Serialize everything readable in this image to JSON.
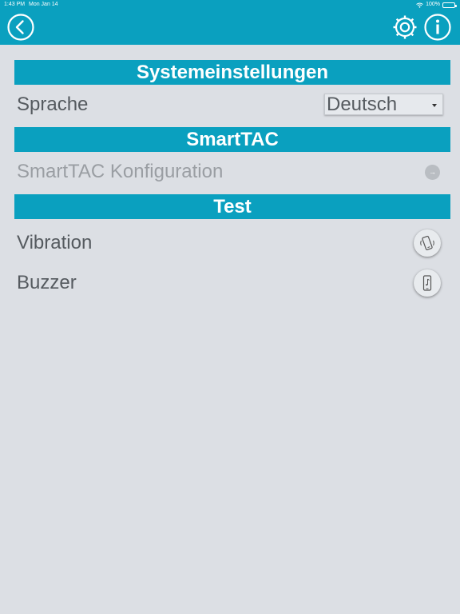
{
  "status_bar": {
    "time": "1:43 PM",
    "date": "Mon Jan 14",
    "battery": "100%"
  },
  "navbar": {
    "back_icon": "chevron-left-circle-icon",
    "settings_icon": "gear-icon",
    "info_icon": "info-circle-icon"
  },
  "sections": {
    "system": {
      "title": "Systemeinstellungen",
      "language_label": "Sprache",
      "language_value": "Deutsch"
    },
    "smarttac": {
      "title": "SmartTAC",
      "config_label": "SmartTAC Konfiguration",
      "config_icon": "→"
    },
    "test": {
      "title": "Test",
      "vibration_label": "Vibration",
      "buzzer_label": "Buzzer"
    }
  },
  "colors": {
    "accent": "#0aa0bf",
    "background": "#dcdfe4",
    "text": "#555a5f",
    "disabled_text": "#9a9ea3"
  }
}
